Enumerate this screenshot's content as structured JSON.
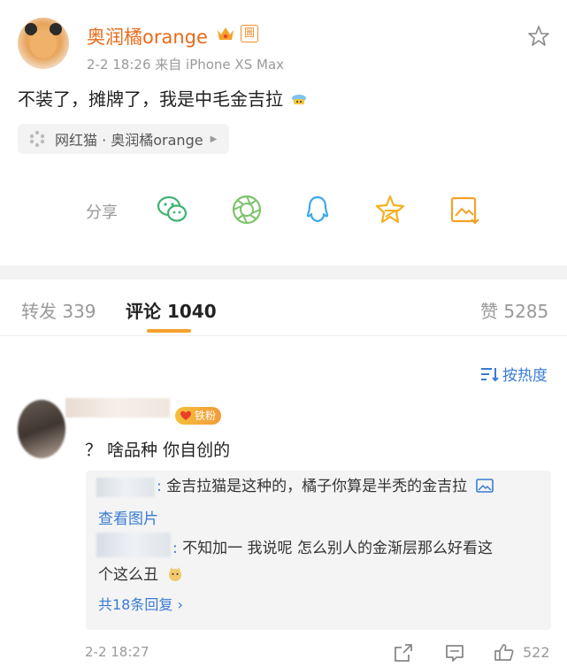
{
  "post": {
    "username": "奥润橘orange",
    "verified_mark": "圖",
    "meta": "2-2 18:26  来自 iPhone XS Max",
    "text": "不装了，摊牌了，我是中毛金吉拉",
    "topic": "网红猫 · 奥润橘orange"
  },
  "share": {
    "label": "分享"
  },
  "tabs": {
    "repost": "转发 339",
    "comments": "评论 1040",
    "likes": "赞 5285"
  },
  "sort": {
    "label": "按热度"
  },
  "comment": {
    "badge": "铁粉",
    "text": "？ 啥品种 你自创的",
    "replies": [
      {
        "text": "金吉拉猫是这种的，橘子你算是半秃的金吉拉",
        "link": "查看图片"
      },
      {
        "text_line1": "不知加一 我说呢 怎么别人的金渐层那么好看这",
        "text_line2": "个这么丑"
      }
    ],
    "more_replies": "共18条回复 ›",
    "time": "2-2 18:27",
    "like_count": "522"
  },
  "colors": {
    "accent": "#f5a12a",
    "link": "#3a7bd5",
    "username": "#e86b1b"
  }
}
